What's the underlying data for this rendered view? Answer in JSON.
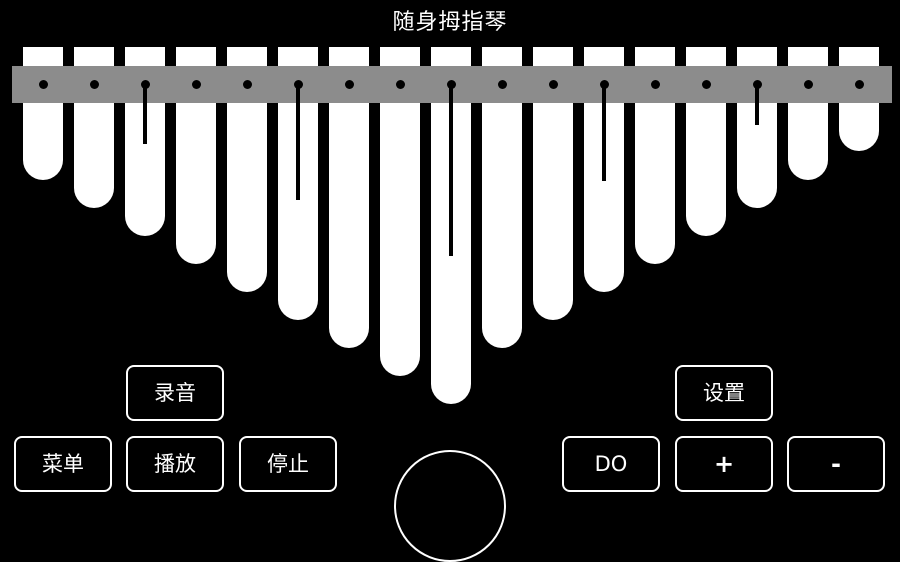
{
  "app": {
    "title": "随身拇指琴"
  },
  "colors": {
    "background": "#000000",
    "tine": "#ffffff",
    "bridge": "#8c8c8c",
    "marker": "#000000"
  },
  "buttons": {
    "record": "录音",
    "menu": "菜单",
    "play": "播放",
    "stop": "停止",
    "settings": "设置",
    "key": "DO",
    "plus": "+",
    "minus": "-"
  }
}
